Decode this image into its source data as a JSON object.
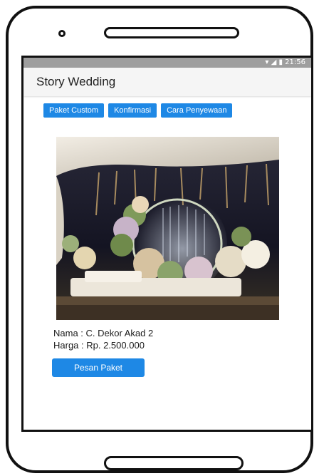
{
  "app": {
    "title": "Story Wedding"
  },
  "status_bar": {
    "time": "21:56"
  },
  "nav": {
    "tabs": [
      {
        "label": "Paket Custom"
      },
      {
        "label": "Konfirmasi"
      },
      {
        "label": "Cara Penyewaan"
      }
    ]
  },
  "package": {
    "name_line": "Nama : C. Dekor Akad 2",
    "price_line": "Harga : Rp. 2.500.000",
    "order_label": "Pesan Paket"
  },
  "colors": {
    "accent": "#1e88e5",
    "status_bar": "#9e9e9e",
    "app_bar": "#f5f5f5"
  },
  "icons": [
    "wifi-icon",
    "signal-icon",
    "battery-icon"
  ]
}
